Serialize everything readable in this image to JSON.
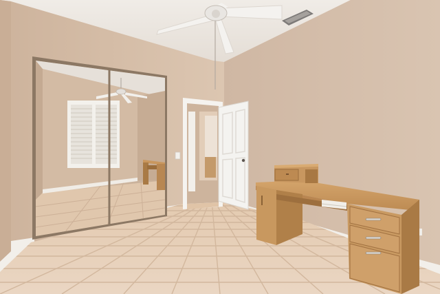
{
  "scene": {
    "room_type": "bedroom-with-desk",
    "colors": {
      "wall": "#d8c1ab",
      "wall_shadow": "#c9b09b",
      "ceiling": "#ece7e1",
      "floor": "#e6cfb8",
      "grout": "#d0b69d",
      "baseboard": "#f3f1ed",
      "desk_wood": "#c99a63",
      "desk_wood_dark": "#a97a45",
      "door": "#f4f3f0",
      "mirror": "#ccb6a0",
      "closet_frame": "#8c7864"
    },
    "objects": [
      "ceiling-fan",
      "ceiling-vent",
      "mirrored-closet-doors",
      "reflected-window-shutters",
      "reflected-ceiling-fan",
      "reflected-desk",
      "open-doorway",
      "interior-door",
      "light-switch",
      "corner-desk",
      "tile-floor",
      "baseboards"
    ]
  }
}
